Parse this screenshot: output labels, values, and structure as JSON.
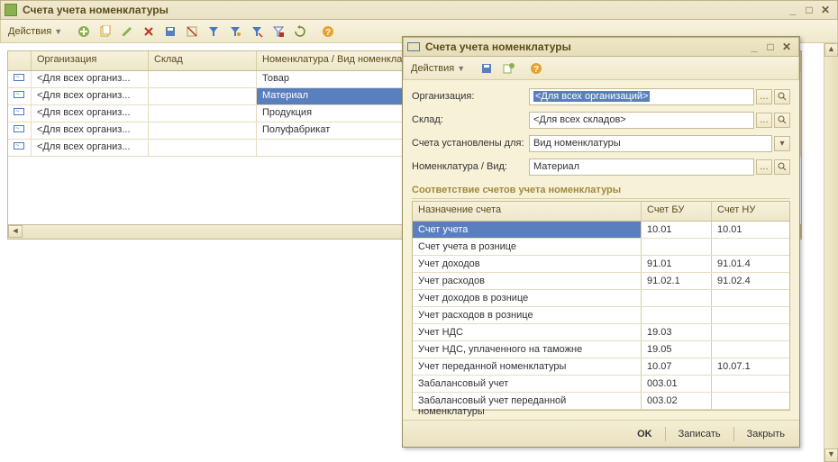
{
  "main": {
    "title": "Счета учета номенклатуры",
    "actions_label": "Действия",
    "columns": {
      "org": "Организация",
      "sklad": "Склад",
      "nom": "Номенклатура / Вид номенклат..."
    },
    "rows": [
      {
        "org": "<Для всех организ...",
        "sklad": "",
        "nom": "Товар",
        "selected": false
      },
      {
        "org": "<Для всех организ...",
        "sklad": "",
        "nom": "Материал",
        "selected": true
      },
      {
        "org": "<Для всех организ...",
        "sklad": "",
        "nom": "Продукция",
        "selected": false
      },
      {
        "org": "<Для всех организ...",
        "sklad": "",
        "nom": "Полуфабрикат",
        "selected": false
      },
      {
        "org": "<Для всех организ...",
        "sklad": "",
        "nom": "",
        "selected": false
      }
    ]
  },
  "dialog": {
    "title": "Счета учета номенклатуры",
    "actions_label": "Действия",
    "form": {
      "org": {
        "label": "Организация:",
        "value": "<Для всех организаций>"
      },
      "sklad": {
        "label": "Склад:",
        "value": "<Для всех складов>"
      },
      "target": {
        "label": "Счета установлены для:",
        "value": "Вид номенклатуры"
      },
      "nom": {
        "label": "Номенклатура / Вид:",
        "value": "Материал"
      }
    },
    "section_header": "Соответствие счетов учета номенклатуры",
    "map_columns": {
      "name": "Назначение счета",
      "bu": "Счет БУ",
      "nu": "Счет НУ"
    },
    "map_rows": [
      {
        "name": "Счет учета",
        "bu": "10.01",
        "nu": "10.01",
        "selected": true
      },
      {
        "name": "Счет учета в рознице",
        "bu": "",
        "nu": "",
        "selected": false
      },
      {
        "name": "Учет доходов",
        "bu": "91.01",
        "nu": "91.01.4",
        "selected": false
      },
      {
        "name": "Учет расходов",
        "bu": "91.02.1",
        "nu": "91.02.4",
        "selected": false
      },
      {
        "name": "Учет доходов в рознице",
        "bu": "",
        "nu": "",
        "selected": false
      },
      {
        "name": "Учет расходов в рознице",
        "bu": "",
        "nu": "",
        "selected": false
      },
      {
        "name": "Учет НДС",
        "bu": "19.03",
        "nu": "",
        "selected": false
      },
      {
        "name": "Учет НДС, уплаченного на таможне",
        "bu": "19.05",
        "nu": "",
        "selected": false
      },
      {
        "name": "Учет переданной номенклатуры",
        "bu": "10.07",
        "nu": "10.07.1",
        "selected": false
      },
      {
        "name": "Забалансовый учет",
        "bu": "003.01",
        "nu": "",
        "selected": false
      },
      {
        "name": "Забалансовый учет переданной номенклатуры",
        "bu": "003.02",
        "nu": "",
        "selected": false
      }
    ],
    "buttons": {
      "ok": "OK",
      "save": "Записать",
      "close": "Закрыть"
    }
  }
}
